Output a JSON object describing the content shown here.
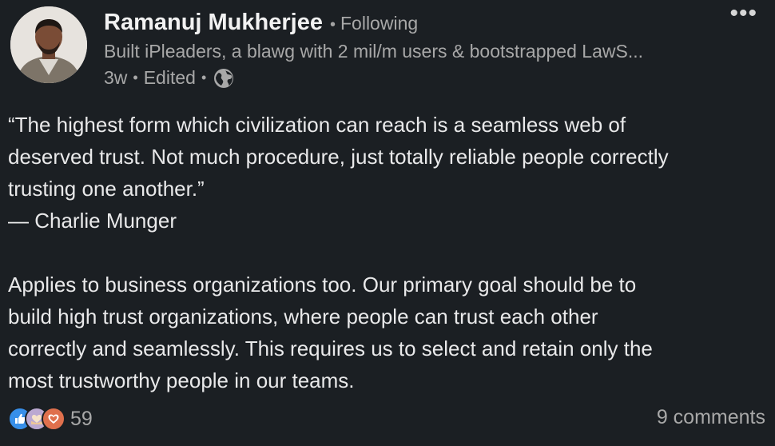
{
  "post": {
    "author": {
      "name": "Ramanuj Mukherjee",
      "relation": "Following",
      "headline": "Built iPleaders, a blawg with 2 mil/m users & bootstrapped LawS...",
      "avatar_icon": "profile-photo"
    },
    "meta": {
      "time": "3w",
      "edited": "Edited",
      "visibility_icon": "globe-icon"
    },
    "more_icon": "ellipsis-icon",
    "more_label": "•••",
    "separator": "•",
    "body": {
      "quote_lines": [
        "“The highest form which civilization can reach is a seamless web of",
        "deserved trust. Not much procedure, just totally reliable people correctly",
        "trusting one another.”",
        "— Charlie Munger"
      ],
      "paragraph_lines": [
        "Applies to business organizations too. Our primary goal should be to",
        "build high trust organizations, where people can trust each other",
        "correctly and seamlessly. This requires us to select and retain only the",
        "most trustworthy people in our teams."
      ]
    },
    "social": {
      "reaction_icons": [
        "like-icon",
        "support-icon",
        "love-icon"
      ],
      "reaction_count": "59",
      "comments": "9 comments"
    }
  },
  "colors": {
    "background": "#1b1f23",
    "text_primary": "#e9e9ea",
    "text_secondary": "#a8a8a8",
    "like": "#378fe9",
    "support": "#bba9d1",
    "love": "#df704d"
  }
}
